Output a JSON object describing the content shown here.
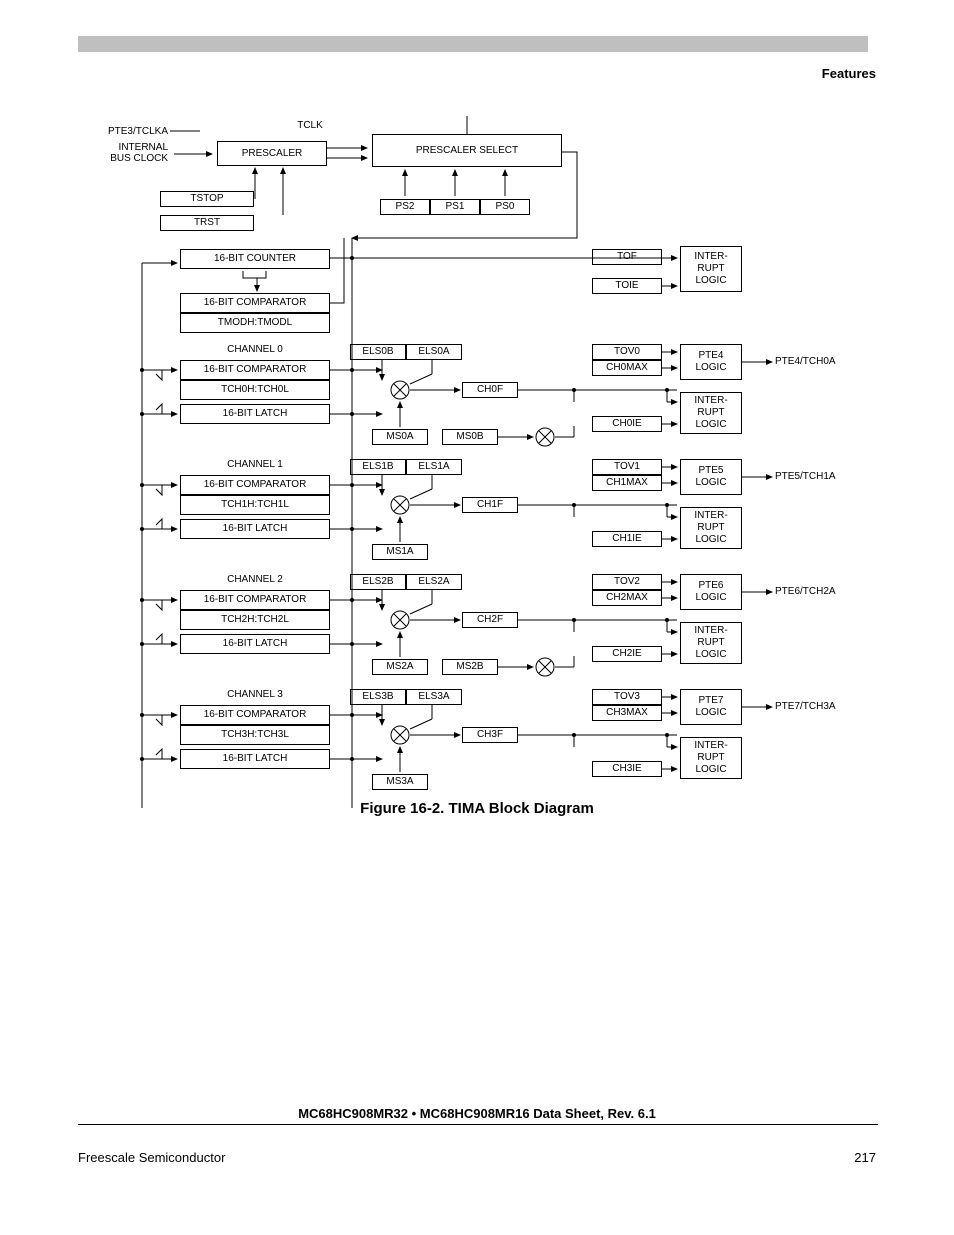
{
  "header": {
    "section": "Features"
  },
  "caption": "Figure 16-2. TIMA Block Diagram",
  "footer": {
    "title": "MC68HC908MR32 • MC68HC908MR16 Data Sheet, Rev. 6.1",
    "left": "Freescale Semiconductor",
    "page": "217"
  },
  "top": {
    "tclk": "TCLK",
    "pte3": "PTE3/TCLKA",
    "prescaler": "PRESCALER",
    "prescaler_select": "PRESCALER SELECT",
    "internal_bus_clock": "INTERNAL\nBUS CLOCK",
    "ps2": "PS2",
    "ps1": "PS1",
    "ps0": "PS0",
    "tstop": "TSTOP",
    "trst": "TRST",
    "counter": "16-BIT COUNTER",
    "comparator": "16-BIT COMPARATOR",
    "tmod": "TMODH:TMODL",
    "tof": "TOF",
    "toie": "TOIE",
    "intlogic": "INTER-\nRUPT\nLOGIC"
  },
  "channels": [
    {
      "title": "CHANNEL 0",
      "comparator": "16-BIT COMPARATOR",
      "reg": "TCH0H:TCH0L",
      "latch": "16-BIT LATCH",
      "elsb": "ELS0B",
      "elsa": "ELS0A",
      "msa": "MS0A",
      "msb": "MS0B",
      "chf": "CH0F",
      "chie": "CH0IE",
      "tov": "TOV0",
      "chmax": "CH0MAX",
      "ptelogic": "PTE4\nLOGIC",
      "pin": "PTE4/TCH0A",
      "intlogic": "INTER-\nRUPT\nLOGIC",
      "show_msb": true
    },
    {
      "title": "CHANNEL 1",
      "comparator": "16-BIT COMPARATOR",
      "reg": "TCH1H:TCH1L",
      "latch": "16-BIT LATCH",
      "elsb": "ELS1B",
      "elsa": "ELS1A",
      "msa": "MS1A",
      "msb": "",
      "chf": "CH1F",
      "chie": "CH1IE",
      "tov": "TOV1",
      "chmax": "CH1MAX",
      "ptelogic": "PTE5\nLOGIC",
      "pin": "PTE5/TCH1A",
      "intlogic": "INTER-\nRUPT\nLOGIC",
      "show_msb": false
    },
    {
      "title": "CHANNEL 2",
      "comparator": "16-BIT COMPARATOR",
      "reg": "TCH2H:TCH2L",
      "latch": "16-BIT LATCH",
      "elsb": "ELS2B",
      "elsa": "ELS2A",
      "msa": "MS2A",
      "msb": "MS2B",
      "chf": "CH2F",
      "chie": "CH2IE",
      "tov": "TOV2",
      "chmax": "CH2MAX",
      "ptelogic": "PTE6\nLOGIC",
      "pin": "PTE6/TCH2A",
      "intlogic": "INTER-\nRUPT\nLOGIC",
      "show_msb": true
    },
    {
      "title": "CHANNEL 3",
      "comparator": "16-BIT COMPARATOR",
      "reg": "TCH3H:TCH3L",
      "latch": "16-BIT LATCH",
      "elsb": "ELS3B",
      "elsa": "ELS3A",
      "msa": "MS3A",
      "msb": "",
      "chf": "CH3F",
      "chie": "CH3IE",
      "tov": "TOV3",
      "chmax": "CH3MAX",
      "ptelogic": "PTE7\nLOGIC",
      "pin": "PTE7/TCH3A",
      "intlogic": "INTER-\nRUPT\nLOGIC",
      "show_msb": false
    }
  ]
}
